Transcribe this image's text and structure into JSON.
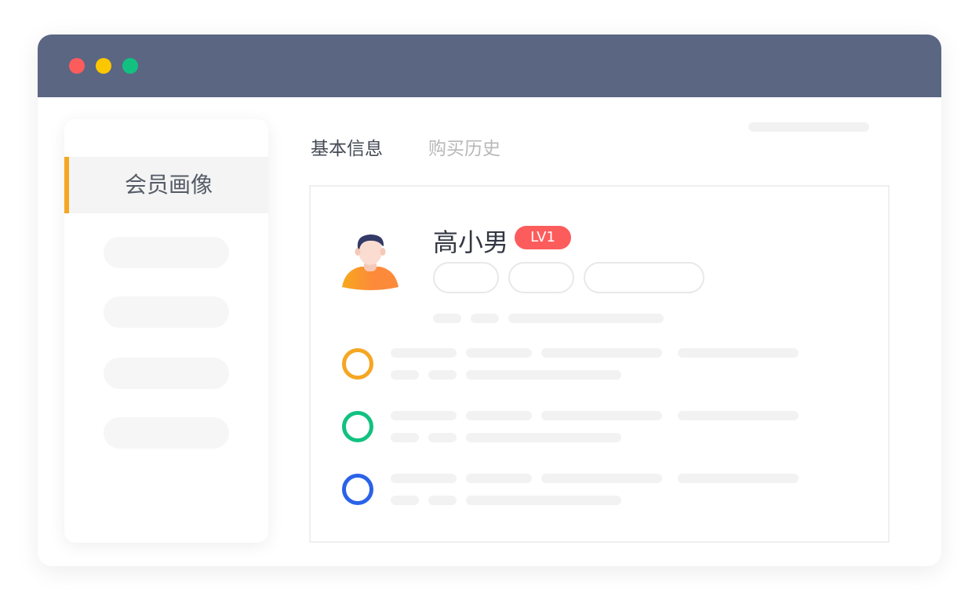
{
  "window": {
    "controls": [
      "close",
      "minimize",
      "maximize"
    ],
    "colors": {
      "titlebar": "#5b6682",
      "close": "#fd5c5c",
      "minimize": "#fdc700",
      "maximize": "#12c180"
    }
  },
  "sidebar": {
    "active_item": {
      "label": "会员画像"
    },
    "accent_color": "#f5a623",
    "placeholder_items": 4
  },
  "tabs": [
    {
      "label": "基本信息",
      "active": true
    },
    {
      "label": "购买历史",
      "active": false
    }
  ],
  "profile": {
    "name": "高小男",
    "level": "LV1",
    "level_color": "#fc5c5c",
    "avatar_icon": "male-user-avatar-icon",
    "tag_placeholders": 3
  },
  "records": [
    {
      "ring_color": "#f5a623",
      "icon": "ring-icon"
    },
    {
      "ring_color": "#12c180",
      "icon": "ring-icon"
    },
    {
      "ring_color": "#2a62e8",
      "icon": "ring-icon"
    }
  ]
}
